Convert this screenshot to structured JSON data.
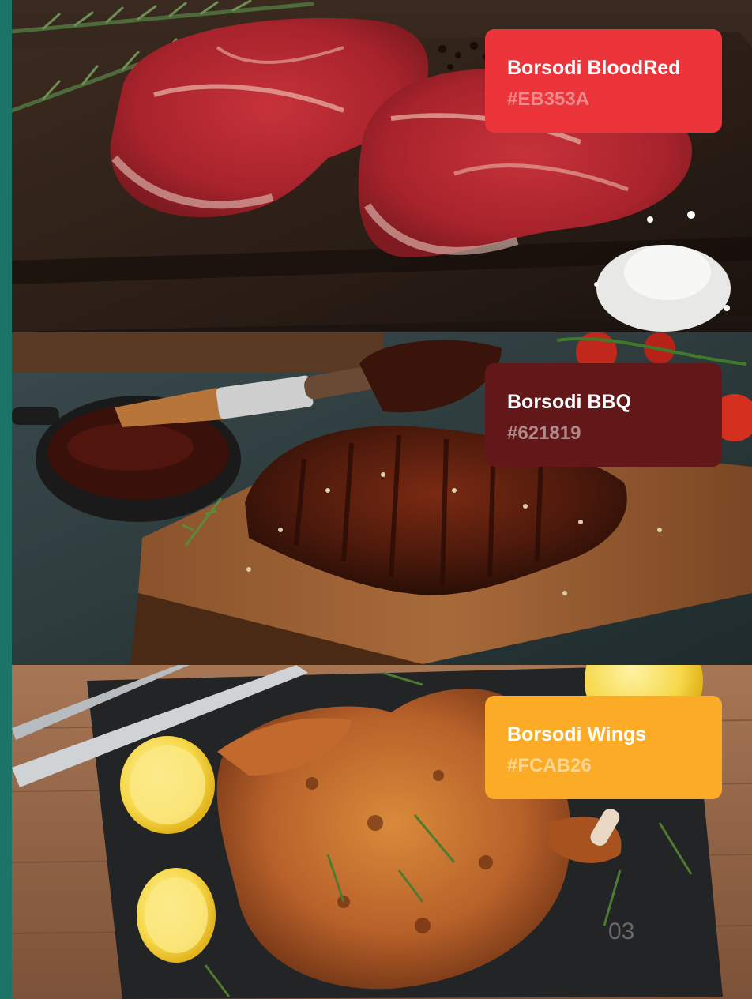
{
  "swatches": [
    {
      "name": "Borsodi BloodRed",
      "hex": "#EB353A",
      "color": "#EB353A"
    },
    {
      "name": "Borsodi BBQ",
      "hex": "#621819",
      "color": "#621819"
    },
    {
      "name": "Borsodi Wings",
      "hex": "#FCAB26",
      "color": "#FCAB26"
    }
  ],
  "page_number": "03",
  "colors": {
    "accent_strip": "#1c7468",
    "board_dark": "#2a1d16",
    "board_wood": "#7a4a28",
    "slate": "#2b3a3c",
    "table_wood": "#9b6c4c"
  }
}
